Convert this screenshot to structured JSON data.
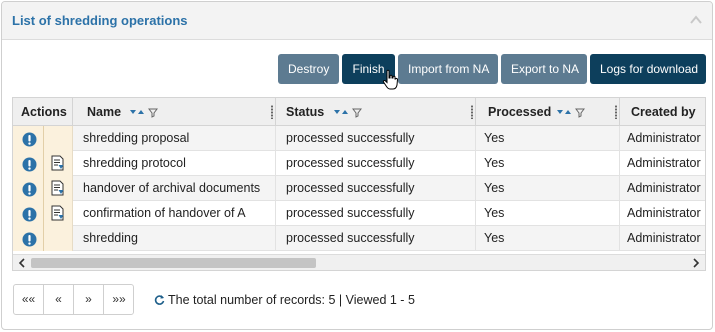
{
  "panel": {
    "title": "List of shredding operations"
  },
  "toolbar": {
    "destroy_label": "Destroy",
    "finish_label": "Finish",
    "import_label": "Import from NA",
    "export_label": "Export to NA",
    "logs_label": "Logs for download"
  },
  "grid": {
    "columns": {
      "actions": "Actions",
      "name": "Name",
      "status": "Status",
      "processed": "Processed",
      "created_by": "Created by"
    },
    "rows": [
      {
        "name": "shredding proposal",
        "status": "processed successfully",
        "processed": "Yes",
        "created_by": "Administrator",
        "has_doc": false
      },
      {
        "name": "shredding protocol",
        "status": "processed successfully",
        "processed": "Yes",
        "created_by": "Administrator",
        "has_doc": true
      },
      {
        "name": "handover of archival documents",
        "status": "processed successfully",
        "processed": "Yes",
        "created_by": "Administrator",
        "has_doc": true
      },
      {
        "name": "confirmation of handover of A",
        "status": "processed successfully",
        "processed": "Yes",
        "created_by": "Administrator",
        "has_doc": true
      },
      {
        "name": "shredding",
        "status": "processed successfully",
        "processed": "Yes",
        "created_by": "Administrator",
        "has_doc": false
      }
    ]
  },
  "pager": {
    "first": "««",
    "prev": "«",
    "next": "»",
    "last": "»»",
    "records_text": "The total number of records: 5 | Viewed 1 - 5"
  },
  "colors": {
    "title": "#2c72a8",
    "button_grey": "#5d7b91",
    "button_dark": "#0d3f5c",
    "info_icon": "#2c72a8",
    "actions_bg": "#fbf1dd"
  }
}
